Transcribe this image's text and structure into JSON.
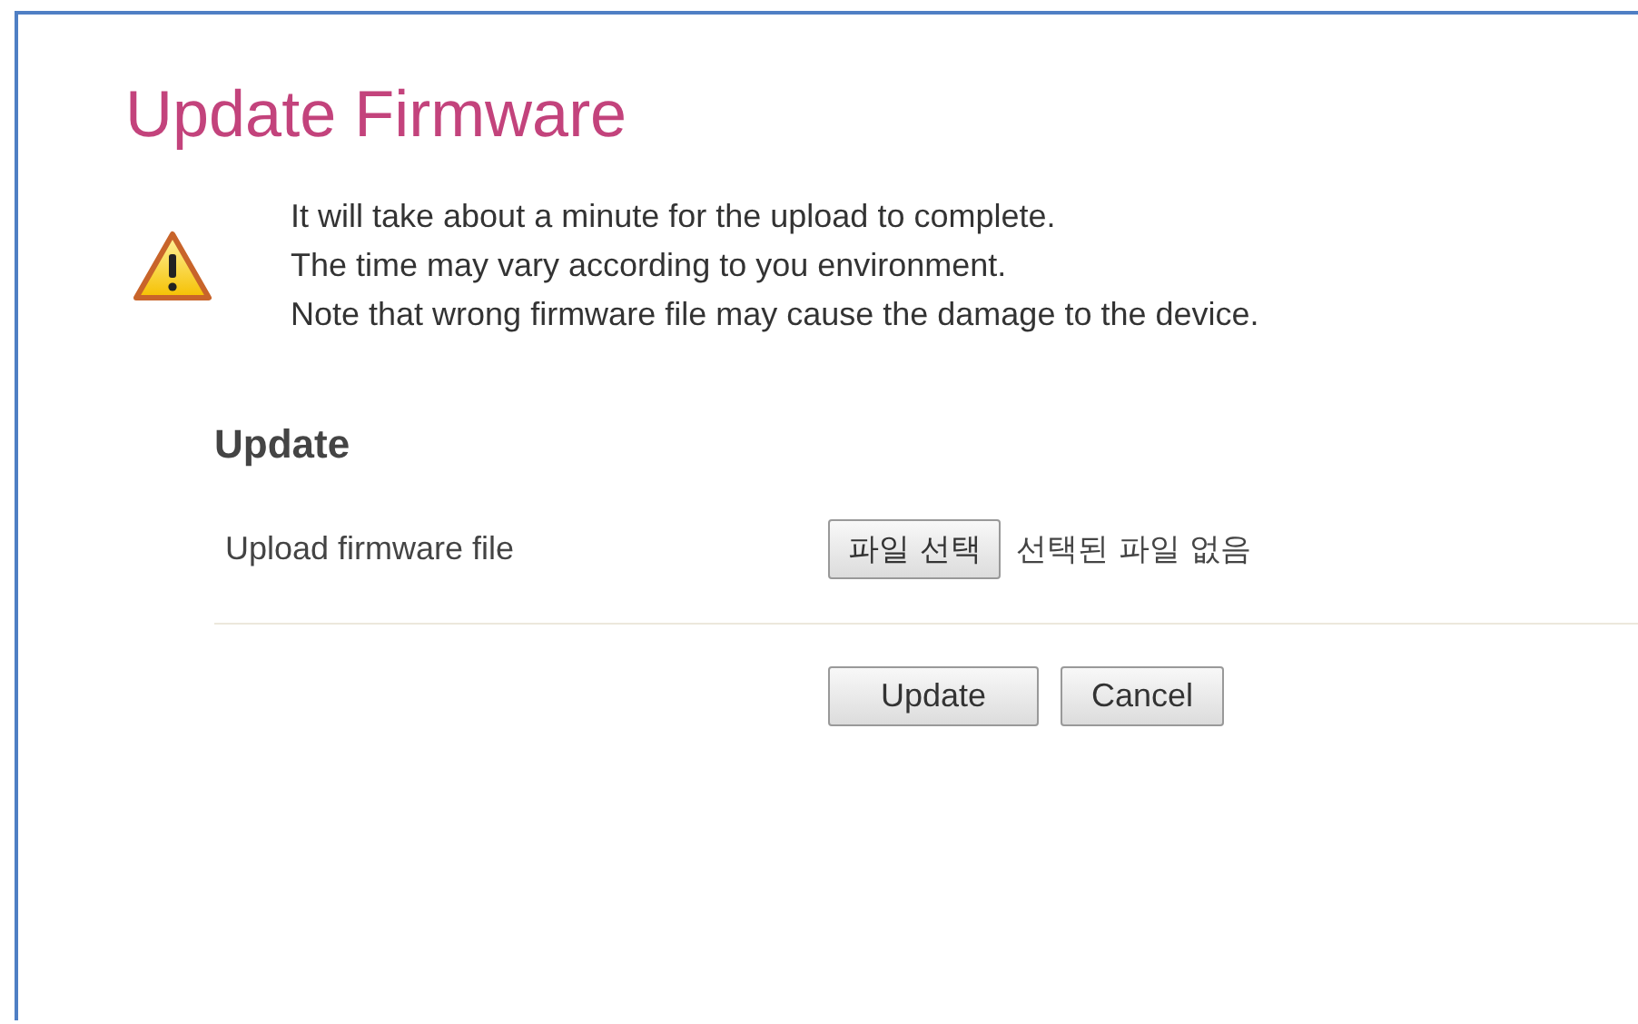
{
  "title": "Update Firmware",
  "notice": {
    "lines": [
      "It will take about a minute for the upload to complete.",
      "The time may vary according to you environment.",
      "Note that wrong firmware file may cause the damage to the device."
    ]
  },
  "section": {
    "heading": "Update",
    "field_label": "Upload firmware file",
    "file_button": "파일 선택",
    "file_status": "선택된 파일 없음"
  },
  "buttons": [
    "Update",
    "Cancel"
  ]
}
